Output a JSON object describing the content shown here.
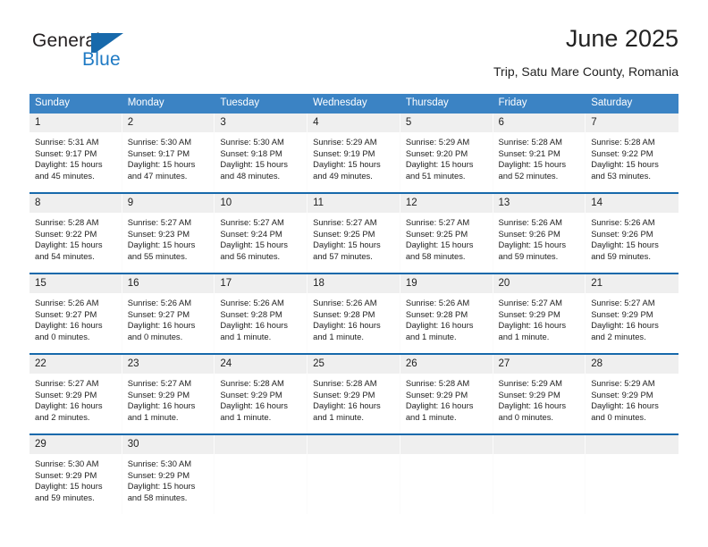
{
  "brand": {
    "line1": "General",
    "line2": "Blue",
    "mark": "triangle-flag-logo"
  },
  "header": {
    "title": "June 2025",
    "subtitle": "Trip, Satu Mare County, Romania"
  },
  "colors": {
    "header_blue": "#3b83c4",
    "rule_blue": "#1769ab",
    "daynum_bg": "#efefef",
    "brand_blue": "#1f7ac4",
    "text": "#222222"
  },
  "weekday_headers": [
    "Sunday",
    "Monday",
    "Tuesday",
    "Wednesday",
    "Thursday",
    "Friday",
    "Saturday"
  ],
  "weeks": [
    [
      {
        "day": "1",
        "sunrise": "Sunrise: 5:31 AM",
        "sunset": "Sunset: 9:17 PM",
        "daylight1": "Daylight: 15 hours",
        "daylight2": "and 45 minutes."
      },
      {
        "day": "2",
        "sunrise": "Sunrise: 5:30 AM",
        "sunset": "Sunset: 9:17 PM",
        "daylight1": "Daylight: 15 hours",
        "daylight2": "and 47 minutes."
      },
      {
        "day": "3",
        "sunrise": "Sunrise: 5:30 AM",
        "sunset": "Sunset: 9:18 PM",
        "daylight1": "Daylight: 15 hours",
        "daylight2": "and 48 minutes."
      },
      {
        "day": "4",
        "sunrise": "Sunrise: 5:29 AM",
        "sunset": "Sunset: 9:19 PM",
        "daylight1": "Daylight: 15 hours",
        "daylight2": "and 49 minutes."
      },
      {
        "day": "5",
        "sunrise": "Sunrise: 5:29 AM",
        "sunset": "Sunset: 9:20 PM",
        "daylight1": "Daylight: 15 hours",
        "daylight2": "and 51 minutes."
      },
      {
        "day": "6",
        "sunrise": "Sunrise: 5:28 AM",
        "sunset": "Sunset: 9:21 PM",
        "daylight1": "Daylight: 15 hours",
        "daylight2": "and 52 minutes."
      },
      {
        "day": "7",
        "sunrise": "Sunrise: 5:28 AM",
        "sunset": "Sunset: 9:22 PM",
        "daylight1": "Daylight: 15 hours",
        "daylight2": "and 53 minutes."
      }
    ],
    [
      {
        "day": "8",
        "sunrise": "Sunrise: 5:28 AM",
        "sunset": "Sunset: 9:22 PM",
        "daylight1": "Daylight: 15 hours",
        "daylight2": "and 54 minutes."
      },
      {
        "day": "9",
        "sunrise": "Sunrise: 5:27 AM",
        "sunset": "Sunset: 9:23 PM",
        "daylight1": "Daylight: 15 hours",
        "daylight2": "and 55 minutes."
      },
      {
        "day": "10",
        "sunrise": "Sunrise: 5:27 AM",
        "sunset": "Sunset: 9:24 PM",
        "daylight1": "Daylight: 15 hours",
        "daylight2": "and 56 minutes."
      },
      {
        "day": "11",
        "sunrise": "Sunrise: 5:27 AM",
        "sunset": "Sunset: 9:25 PM",
        "daylight1": "Daylight: 15 hours",
        "daylight2": "and 57 minutes."
      },
      {
        "day": "12",
        "sunrise": "Sunrise: 5:27 AM",
        "sunset": "Sunset: 9:25 PM",
        "daylight1": "Daylight: 15 hours",
        "daylight2": "and 58 minutes."
      },
      {
        "day": "13",
        "sunrise": "Sunrise: 5:26 AM",
        "sunset": "Sunset: 9:26 PM",
        "daylight1": "Daylight: 15 hours",
        "daylight2": "and 59 minutes."
      },
      {
        "day": "14",
        "sunrise": "Sunrise: 5:26 AM",
        "sunset": "Sunset: 9:26 PM",
        "daylight1": "Daylight: 15 hours",
        "daylight2": "and 59 minutes."
      }
    ],
    [
      {
        "day": "15",
        "sunrise": "Sunrise: 5:26 AM",
        "sunset": "Sunset: 9:27 PM",
        "daylight1": "Daylight: 16 hours",
        "daylight2": "and 0 minutes."
      },
      {
        "day": "16",
        "sunrise": "Sunrise: 5:26 AM",
        "sunset": "Sunset: 9:27 PM",
        "daylight1": "Daylight: 16 hours",
        "daylight2": "and 0 minutes."
      },
      {
        "day": "17",
        "sunrise": "Sunrise: 5:26 AM",
        "sunset": "Sunset: 9:28 PM",
        "daylight1": "Daylight: 16 hours",
        "daylight2": "and 1 minute."
      },
      {
        "day": "18",
        "sunrise": "Sunrise: 5:26 AM",
        "sunset": "Sunset: 9:28 PM",
        "daylight1": "Daylight: 16 hours",
        "daylight2": "and 1 minute."
      },
      {
        "day": "19",
        "sunrise": "Sunrise: 5:26 AM",
        "sunset": "Sunset: 9:28 PM",
        "daylight1": "Daylight: 16 hours",
        "daylight2": "and 1 minute."
      },
      {
        "day": "20",
        "sunrise": "Sunrise: 5:27 AM",
        "sunset": "Sunset: 9:29 PM",
        "daylight1": "Daylight: 16 hours",
        "daylight2": "and 1 minute."
      },
      {
        "day": "21",
        "sunrise": "Sunrise: 5:27 AM",
        "sunset": "Sunset: 9:29 PM",
        "daylight1": "Daylight: 16 hours",
        "daylight2": "and 2 minutes."
      }
    ],
    [
      {
        "day": "22",
        "sunrise": "Sunrise: 5:27 AM",
        "sunset": "Sunset: 9:29 PM",
        "daylight1": "Daylight: 16 hours",
        "daylight2": "and 2 minutes."
      },
      {
        "day": "23",
        "sunrise": "Sunrise: 5:27 AM",
        "sunset": "Sunset: 9:29 PM",
        "daylight1": "Daylight: 16 hours",
        "daylight2": "and 1 minute."
      },
      {
        "day": "24",
        "sunrise": "Sunrise: 5:28 AM",
        "sunset": "Sunset: 9:29 PM",
        "daylight1": "Daylight: 16 hours",
        "daylight2": "and 1 minute."
      },
      {
        "day": "25",
        "sunrise": "Sunrise: 5:28 AM",
        "sunset": "Sunset: 9:29 PM",
        "daylight1": "Daylight: 16 hours",
        "daylight2": "and 1 minute."
      },
      {
        "day": "26",
        "sunrise": "Sunrise: 5:28 AM",
        "sunset": "Sunset: 9:29 PM",
        "daylight1": "Daylight: 16 hours",
        "daylight2": "and 1 minute."
      },
      {
        "day": "27",
        "sunrise": "Sunrise: 5:29 AM",
        "sunset": "Sunset: 9:29 PM",
        "daylight1": "Daylight: 16 hours",
        "daylight2": "and 0 minutes."
      },
      {
        "day": "28",
        "sunrise": "Sunrise: 5:29 AM",
        "sunset": "Sunset: 9:29 PM",
        "daylight1": "Daylight: 16 hours",
        "daylight2": "and 0 minutes."
      }
    ],
    [
      {
        "day": "29",
        "sunrise": "Sunrise: 5:30 AM",
        "sunset": "Sunset: 9:29 PM",
        "daylight1": "Daylight: 15 hours",
        "daylight2": "and 59 minutes."
      },
      {
        "day": "30",
        "sunrise": "Sunrise: 5:30 AM",
        "sunset": "Sunset: 9:29 PM",
        "daylight1": "Daylight: 15 hours",
        "daylight2": "and 58 minutes."
      },
      {
        "day": "",
        "sunrise": "",
        "sunset": "",
        "daylight1": "",
        "daylight2": ""
      },
      {
        "day": "",
        "sunrise": "",
        "sunset": "",
        "daylight1": "",
        "daylight2": ""
      },
      {
        "day": "",
        "sunrise": "",
        "sunset": "",
        "daylight1": "",
        "daylight2": ""
      },
      {
        "day": "",
        "sunrise": "",
        "sunset": "",
        "daylight1": "",
        "daylight2": ""
      },
      {
        "day": "",
        "sunrise": "",
        "sunset": "",
        "daylight1": "",
        "daylight2": ""
      }
    ]
  ]
}
